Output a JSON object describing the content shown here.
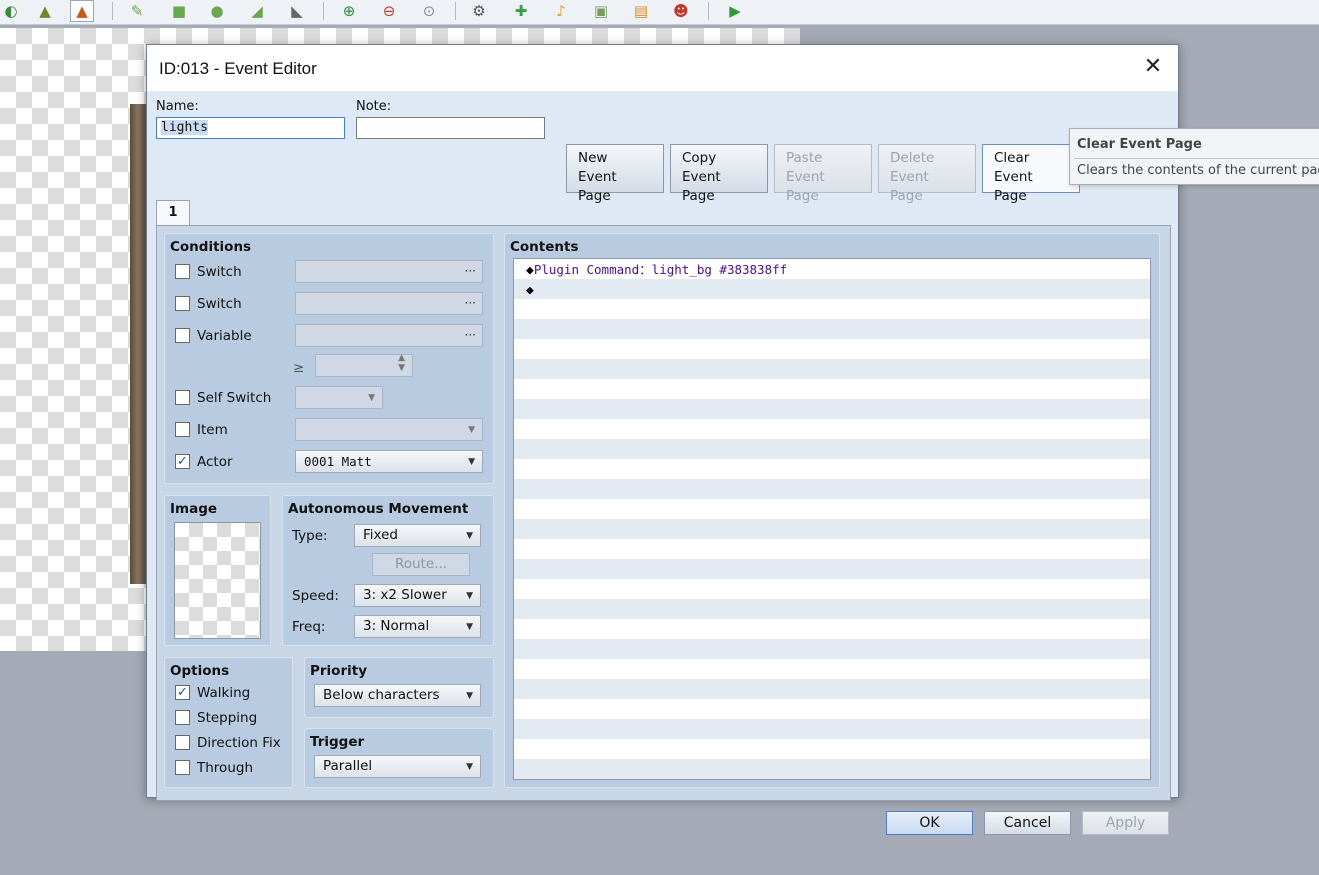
{
  "toolbar": {
    "icons": [
      "map-icon",
      "event-layer-icon",
      "pencil-icon",
      "rectangle-icon",
      "ellipse-icon",
      "fill-icon",
      "shadow-pen-icon",
      "zoom-in-icon",
      "zoom-out-icon",
      "zoom-reset-icon",
      "database-icon",
      "plugin-icon",
      "sound-icon",
      "resource-icon",
      "character-generator-icon",
      "playtest-icon"
    ]
  },
  "dialog": {
    "title": "ID:013 - Event Editor",
    "close_glyph": "✕"
  },
  "header": {
    "name_label": "Name:",
    "name_value": "lights",
    "note_label": "Note:",
    "note_value": ""
  },
  "page_buttons": {
    "new": {
      "line1": "New",
      "line2": "Event Page"
    },
    "copy": {
      "line1": "Copy",
      "line2": "Event Page"
    },
    "paste": {
      "line1": "Paste",
      "line2": "Event Page"
    },
    "delete": {
      "line1": "Delete",
      "line2": "Event Page"
    },
    "clear": {
      "line1": "Clear",
      "line2": "Event Page"
    }
  },
  "tabs": [
    {
      "label": "1"
    }
  ],
  "conditions": {
    "title": "Conditions",
    "switch1": {
      "label": "Switch",
      "checked": false,
      "value": "",
      "ellipsis": "···"
    },
    "switch2": {
      "label": "Switch",
      "checked": false,
      "value": "",
      "ellipsis": "···"
    },
    "variable": {
      "label": "Variable",
      "checked": false,
      "value": "",
      "ellipsis": "···"
    },
    "variable_op": "≥",
    "variable_value": "",
    "self_switch": {
      "label": "Self Switch",
      "checked": false,
      "value": ""
    },
    "item": {
      "label": "Item",
      "checked": false,
      "value": ""
    },
    "actor": {
      "label": "Actor",
      "checked": true,
      "value": "0001 Matt"
    }
  },
  "image": {
    "title": "Image"
  },
  "movement": {
    "title": "Autonomous Movement",
    "type_label": "Type:",
    "type_value": "Fixed",
    "route_button": "Route...",
    "speed_label": "Speed:",
    "speed_value": "3: x2 Slower",
    "freq_label": "Freq:",
    "freq_value": "3: Normal"
  },
  "options": {
    "title": "Options",
    "walking": {
      "label": "Walking",
      "checked": true
    },
    "stepping": {
      "label": "Stepping",
      "checked": false
    },
    "direction_fix": {
      "label": "Direction Fix",
      "checked": false
    },
    "through": {
      "label": "Through",
      "checked": false
    }
  },
  "priority": {
    "title": "Priority",
    "value": "Below characters"
  },
  "trigger": {
    "title": "Trigger",
    "value": "Parallel"
  },
  "contents": {
    "title": "Contents",
    "commands": [
      {
        "marker": "◆",
        "text": "Plugin Command：light_bg #383838ff"
      },
      {
        "marker": "◆",
        "text": ""
      }
    ]
  },
  "footer": {
    "ok": "OK",
    "cancel": "Cancel",
    "apply": "Apply"
  },
  "tooltip": {
    "title": "Clear Event Page",
    "description": "Clears the contents of the current page."
  },
  "colors": {
    "dialog_bg": "#dfe9f5",
    "panel_bg": "#b9cbe0",
    "command_text": "#4b1082",
    "checkmark": "#1d4e9a"
  }
}
